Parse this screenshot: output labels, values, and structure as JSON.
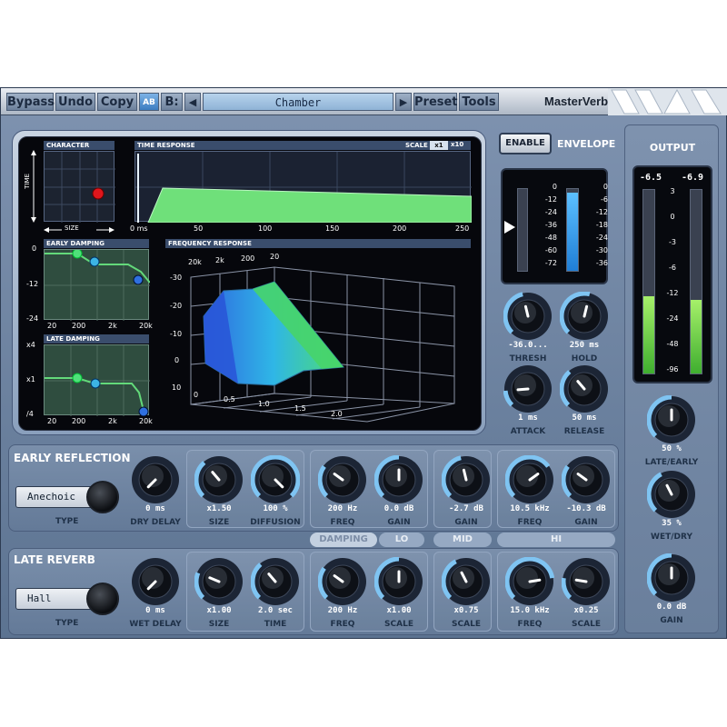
{
  "toolbar": {
    "bypass": "Bypass",
    "undo": "Undo",
    "copy": "Copy",
    "ab": "AB",
    "b": "B:",
    "prev_arrow": "◀",
    "next_arrow": "▶",
    "preset_name": "Chamber",
    "preset": "Preset",
    "tools": "Tools",
    "brand": "MasterVerb"
  },
  "display": {
    "character": {
      "title": "CHARACTER",
      "y_axis": "TIME",
      "x_axis": "SIZE"
    },
    "time_response": {
      "title": "TIME RESPONSE",
      "scale_label": "SCALE",
      "scale_options": [
        "x1",
        "x10"
      ],
      "x_ticks": [
        "0 ms",
        "50",
        "100",
        "150",
        "200",
        "250"
      ]
    },
    "early_damping": {
      "title": "EARLY DAMPING",
      "y_ticks": [
        "0",
        "-12",
        "-24"
      ],
      "x_ticks": [
        "20",
        "200",
        "2k",
        "20k"
      ]
    },
    "late_damping": {
      "title": "LATE DAMPING",
      "y_ticks": [
        "x4",
        "x1",
        "/4"
      ],
      "x_ticks": [
        "20",
        "200",
        "2k",
        "20k"
      ]
    },
    "frequency_response": {
      "title": "FREQUENCY RESPONSE",
      "freq_ticks": [
        "20k",
        "2k",
        "200",
        "20"
      ],
      "db_ticks": [
        "-30",
        "-20",
        "-10",
        "0",
        "10"
      ],
      "time_ticks": [
        "0",
        "0.5",
        "1.0",
        "1.5",
        "2.0"
      ]
    }
  },
  "envelope": {
    "enable": "ENABLE",
    "title": "ENVELOPE",
    "left_scale": [
      "0",
      "-12",
      "-24",
      "-36",
      "-48",
      "-60",
      "-72"
    ],
    "right_scale": [
      "0",
      "-6",
      "-12",
      "-18",
      "-24",
      "-30",
      "-36"
    ],
    "knobs": [
      {
        "label": "THRESH",
        "value": "-36.0..."
      },
      {
        "label": "HOLD",
        "value": "250 ms"
      },
      {
        "label": "ATTACK",
        "value": "1 ms"
      },
      {
        "label": "RELEASE",
        "value": "50 ms"
      }
    ]
  },
  "output": {
    "title": "OUTPUT",
    "peak_left": "-6.5",
    "peak_right": "-6.9",
    "scale": [
      "3",
      "0",
      "-3",
      "-6",
      "-12",
      "-24",
      "-48",
      "-96"
    ],
    "level_left": 0.42,
    "level_right": 0.4,
    "knobs": [
      {
        "label": "LATE/EARLY",
        "value": "50 %"
      },
      {
        "label": "WET/DRY",
        "value": "35 %"
      },
      {
        "label": "GAIN",
        "value": "0.0 dB"
      }
    ]
  },
  "early_reflection": {
    "title": "EARLY REFLECTION",
    "type_value": "Anechoic",
    "type_label": "TYPE",
    "knobs": [
      {
        "label": "DRY DELAY",
        "value": "0 ms"
      },
      {
        "label": "SIZE",
        "value": "x1.50"
      },
      {
        "label": "DIFFUSION",
        "value": "100 %"
      },
      {
        "label": "FREQ",
        "value": "200 Hz"
      },
      {
        "label": "GAIN",
        "value": "0.0 dB"
      },
      {
        "label": "GAIN",
        "value": "-2.7 dB"
      },
      {
        "label": "FREQ",
        "value": "10.5 kHz"
      },
      {
        "label": "GAIN",
        "value": "-10.3 dB"
      }
    ]
  },
  "damping_tabs": {
    "damping": "DAMPING",
    "lo": "LO",
    "mid": "MID",
    "hi": "HI"
  },
  "late_reverb": {
    "title": "LATE REVERB",
    "type_value": "Hall",
    "type_label": "TYPE",
    "knobs": [
      {
        "label": "WET DELAY",
        "value": "0 ms"
      },
      {
        "label": "SIZE",
        "value": "x1.00"
      },
      {
        "label": "TIME",
        "value": "2.0 sec"
      },
      {
        "label": "FREQ",
        "value": "200 Hz"
      },
      {
        "label": "SCALE",
        "value": "x1.00"
      },
      {
        "label": "SCALE",
        "value": "x0.75"
      },
      {
        "label": "FREQ",
        "value": "15.0 kHz"
      },
      {
        "label": "SCALE",
        "value": "x0.25"
      }
    ]
  },
  "colors": {
    "accent_blue": "#7fc4f2",
    "meter_green": "#7ddc4a",
    "meter_blue": "#2f8fe0",
    "curve_green": "#5fd06a"
  }
}
